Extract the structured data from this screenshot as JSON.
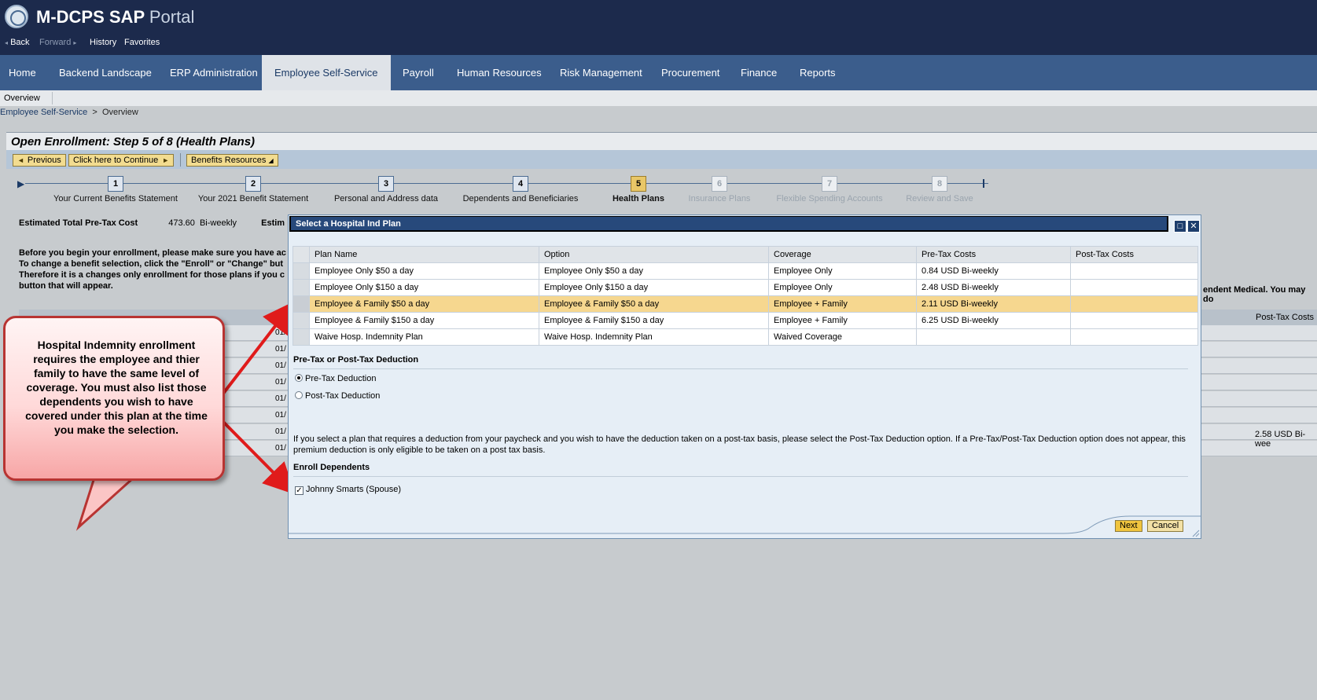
{
  "header": {
    "title_main": "M-DCPS SAP",
    "title_sub": "Portal",
    "back": "Back",
    "forward": "Forward",
    "history": "History",
    "favorites": "Favorites"
  },
  "nav": {
    "tabs": [
      "Home",
      "Backend Landscape",
      "ERP Administration",
      "Employee Self-Service",
      "Payroll",
      "Human Resources",
      "Risk Management",
      "Procurement",
      "Finance",
      "Reports"
    ],
    "active_tab": "Employee Self-Service",
    "subnav": "Overview"
  },
  "breadcrumb": {
    "root": "Employee Self-Service",
    "sep": ">",
    "current": "Overview"
  },
  "page": {
    "title": "Open Enrollment: Step 5  of 8  (Health Plans)",
    "btn_previous": "Previous",
    "btn_continue": "Click here to Continue",
    "btn_resources": "Benefits Resources"
  },
  "roadmap": [
    {
      "num": "1",
      "label": "Your Current Benefits Statement"
    },
    {
      "num": "2",
      "label": "Your 2021 Benefit Statement"
    },
    {
      "num": "3",
      "label": "Personal and Address data"
    },
    {
      "num": "4",
      "label": "Dependents and Beneficiaries"
    },
    {
      "num": "5",
      "label": "Health Plans"
    },
    {
      "num": "6",
      "label": "Insurance Plans"
    },
    {
      "num": "7",
      "label": "Flexible Spending Accounts"
    },
    {
      "num": "8",
      "label": "Review and Save"
    }
  ],
  "costs": {
    "label": "Estimated Total Pre-Tax Cost",
    "value": "473.60",
    "period": "Bi-weekly",
    "label2": "Estim"
  },
  "intro": {
    "line1": "Before you begin your enrollment, please make sure you have ac",
    "line2": "To change a benefit selection, click the \"Enroll\" or \"Change\" but",
    "line3": "Therefore it is a changes only enrollment for those plans if you c",
    "line4": "button that will appear.",
    "right_fragment": "endent Medical. You may do"
  },
  "bg_table": {
    "header_right": "Post-Tax Costs",
    "dates": [
      "01/",
      "01/",
      "01/",
      "01/",
      "01/",
      "01/",
      "01/",
      "01/"
    ],
    "right_value": "2.58 USD Bi-wee"
  },
  "callout": {
    "text": "Hospital Indemnity enrollment requires the employee and thier family to have the same level of coverage.  You must also list those dependents you wish to have covered under this plan at the time you make the selection."
  },
  "modal": {
    "title": "Select a Hospital Ind Plan",
    "columns": [
      "Plan Name",
      "Option",
      "Coverage",
      "Pre-Tax Costs",
      "Post-Tax Costs"
    ],
    "rows": [
      {
        "plan": "Employee Only $50 a day",
        "option": "Employee Only $50 a day",
        "coverage": "Employee Only",
        "pretax": "0.84 USD Bi-weekly",
        "posttax": ""
      },
      {
        "plan": "Employee Only $150 a day",
        "option": "Employee Only $150 a day",
        "coverage": "Employee Only",
        "pretax": "2.48 USD Bi-weekly",
        "posttax": ""
      },
      {
        "plan": "Employee & Family $50 a day",
        "option": "Employee & Family $50 a day",
        "coverage": "Employee + Family",
        "pretax": "2.11 USD Bi-weekly",
        "posttax": ""
      },
      {
        "plan": "Employee & Family $150 a day",
        "option": "Employee & Family $150 a day",
        "coverage": "Employee + Family",
        "pretax": "6.25 USD Bi-weekly",
        "posttax": ""
      },
      {
        "plan": "Waive Hosp. Indemnity Plan",
        "option": "Waive Hosp. Indemnity Plan",
        "coverage": "Waived Coverage",
        "pretax": "",
        "posttax": ""
      }
    ],
    "deduction_title": "Pre-Tax or Post-Tax Deduction",
    "opt_pretax": "Pre-Tax Deduction",
    "opt_posttax": "Post-Tax Deduction",
    "note": "If you select a plan that requires a deduction from your paycheck and you wish to have the deduction taken on a post-tax basis, please select the Post-Tax Deduction option. If a Pre-Tax/Post-Tax Deduction option does not appear, this premium deduction is only eligible to be taken on a post tax basis.",
    "dependents_title": "Enroll Dependents",
    "dependent": "Johnny Smarts (Spouse)",
    "next": "Next",
    "cancel": "Cancel"
  },
  "colors": {
    "header": "#1c2a4c",
    "nav": "#3b5d8c",
    "highlight_row": "#f6d78f",
    "callout_border": "#b83432",
    "arrow": "#e01b1b"
  }
}
